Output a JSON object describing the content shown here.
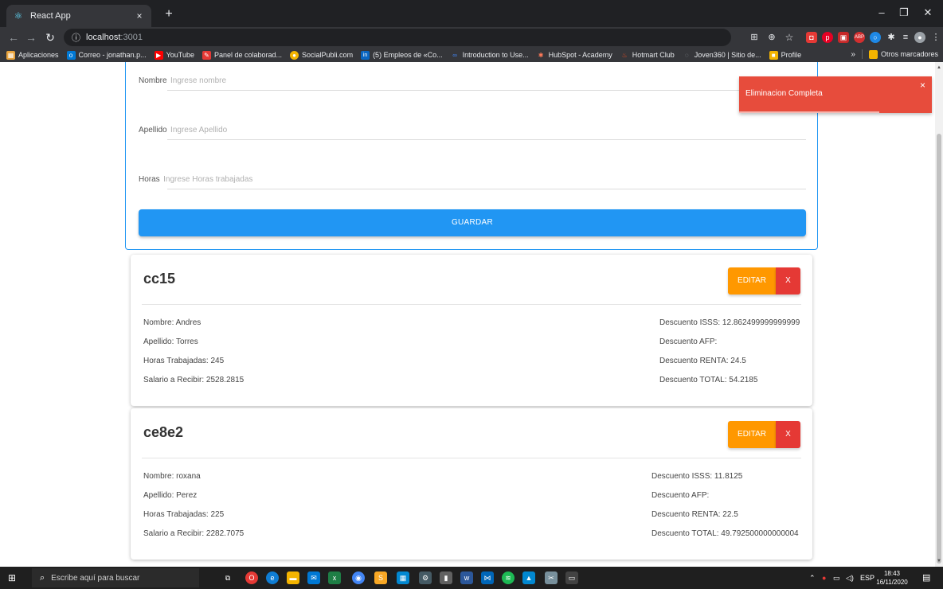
{
  "browser": {
    "tab_title": "React App",
    "tab_close": "×",
    "new_tab": "+",
    "url_host": "localhost",
    "url_port": ":3001",
    "window_controls": [
      "–",
      "❐",
      "✕"
    ],
    "bookmarks": [
      {
        "label": "Aplicaciones",
        "icon": "apps-grid-icon",
        "color": "#e8a33d",
        "glyph": "▦"
      },
      {
        "label": "Correo - jonathan.p...",
        "icon": "outlook-icon",
        "color": "#0078d4",
        "glyph": "o"
      },
      {
        "label": "YouTube",
        "icon": "youtube-icon",
        "color": "#ff0000",
        "glyph": "▶"
      },
      {
        "label": "Panel de colaborad...",
        "icon": "panel-icon",
        "color": "#e53935",
        "glyph": "✎"
      },
      {
        "label": "SocialPubli.com",
        "icon": "socialpubli-icon",
        "color": "#f4b400",
        "glyph": "●"
      },
      {
        "label": "(5) Empleos de «Co...",
        "icon": "linkedin-icon",
        "color": "#0a66c2",
        "glyph": "in"
      },
      {
        "label": "Introduction to Use...",
        "icon": "infinity-icon",
        "color": "#4285f4",
        "glyph": "∞"
      },
      {
        "label": "HubSpot - Academy",
        "icon": "hubspot-icon",
        "color": "#ff7a59",
        "glyph": "✱"
      },
      {
        "label": "Hotmart Club",
        "icon": "hotmart-icon",
        "color": "#f04e23",
        "glyph": "♨"
      },
      {
        "label": "Joven360 | Sitio de...",
        "icon": "joven360-icon",
        "color": "#9aa0a6",
        "glyph": "◌"
      },
      {
        "label": "Profile",
        "icon": "profile-icon",
        "color": "#f4b400",
        "glyph": "■"
      }
    ],
    "bookmarks_more": "»",
    "other_bookmarks": "Otros marcadores"
  },
  "form": {
    "nombre": {
      "label": "Nombre",
      "placeholder": "Ingrese nombre"
    },
    "apellido": {
      "label": "Apellido",
      "placeholder": "Ingrese Apellido"
    },
    "horas": {
      "label": "Horas",
      "placeholder": "Ingrese Horas trabajadas"
    },
    "save_label": "GUARDAR"
  },
  "employees": [
    {
      "code": "cc15",
      "edit_label": "EDITAR",
      "delete_label": "X",
      "nombre": "Nombre: Andres",
      "apellido": "Apellido: Torres",
      "horas": "Horas Trabajadas: 245",
      "salario": "Salario a Recibir: 2528.2815",
      "isss": "Descuento ISSS: 12.862499999999999",
      "afp": "Descuento AFP:",
      "renta": "Descuento RENTA: 24.5",
      "total": "Descuento TOTAL: 54.2185"
    },
    {
      "code": "ce8e2",
      "edit_label": "EDITAR",
      "delete_label": "X",
      "nombre": "Nombre: roxana",
      "apellido": "Apellido: Perez",
      "horas": "Horas Trabajadas: 225",
      "salario": "Salario a Recibir: 2282.7075",
      "isss": "Descuento ISSS: 11.8125",
      "afp": "Descuento AFP:",
      "renta": "Descuento RENTA: 22.5",
      "total": "Descuento TOTAL: 49.792500000000004"
    }
  ],
  "toast": {
    "message": "Eliminacion Completa",
    "close": "×",
    "color": "#e74c3c"
  },
  "taskbar": {
    "search_placeholder": "Escribe aquí para buscar",
    "language": "ESP",
    "time": "18:43",
    "date": "16/11/2020"
  },
  "colors": {
    "primary": "#2196f3",
    "edit": "#ff9800",
    "delete": "#e53935"
  }
}
